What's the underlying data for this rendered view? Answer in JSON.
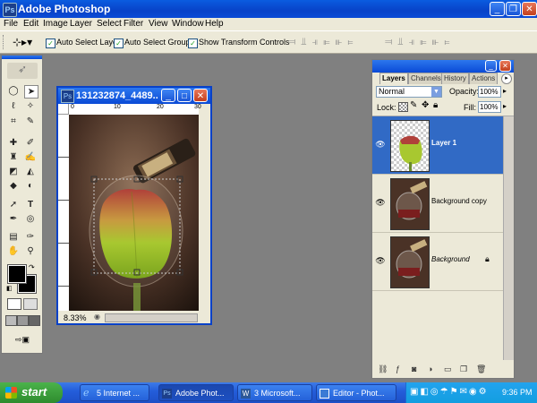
{
  "window": {
    "title": "Adobe Photoshop"
  },
  "menu": [
    "File",
    "Edit",
    "Image",
    "Layer",
    "Select",
    "Filter",
    "View",
    "Window",
    "Help"
  ],
  "options": {
    "auto_select_layer": "Auto Select Layer",
    "auto_select_groups": "Auto Select Groups",
    "show_transform_controls": "Show Transform Controls"
  },
  "document": {
    "title": "131232874_4489...",
    "zoom": "8.33%",
    "ruler_labels": [
      "0",
      "10",
      "20",
      "30"
    ]
  },
  "layers_panel": {
    "tabs": [
      "Layers",
      "Channels",
      "History",
      "Actions"
    ],
    "blend_mode": "Normal",
    "opacity_label": "Opacity:",
    "opacity_value": "100%",
    "lock_label": "Lock:",
    "fill_label": "Fill:",
    "fill_value": "100%",
    "layers": [
      {
        "name": "Layer 1",
        "selected": true
      },
      {
        "name": "Background copy",
        "selected": false
      },
      {
        "name": "Background",
        "selected": false,
        "locked": true
      }
    ]
  },
  "taskbar": {
    "start": "start",
    "items": [
      "5 Internet ...",
      "Adobe Phot...",
      "3 Microsoft...",
      "Editor - Phot..."
    ],
    "clock": "9:36 PM"
  },
  "colors": {
    "title_blue": "#0a4ad6",
    "selection_blue": "#316ac5",
    "taskbar_blue": "#245edb",
    "start_green": "#2e8b2e"
  }
}
